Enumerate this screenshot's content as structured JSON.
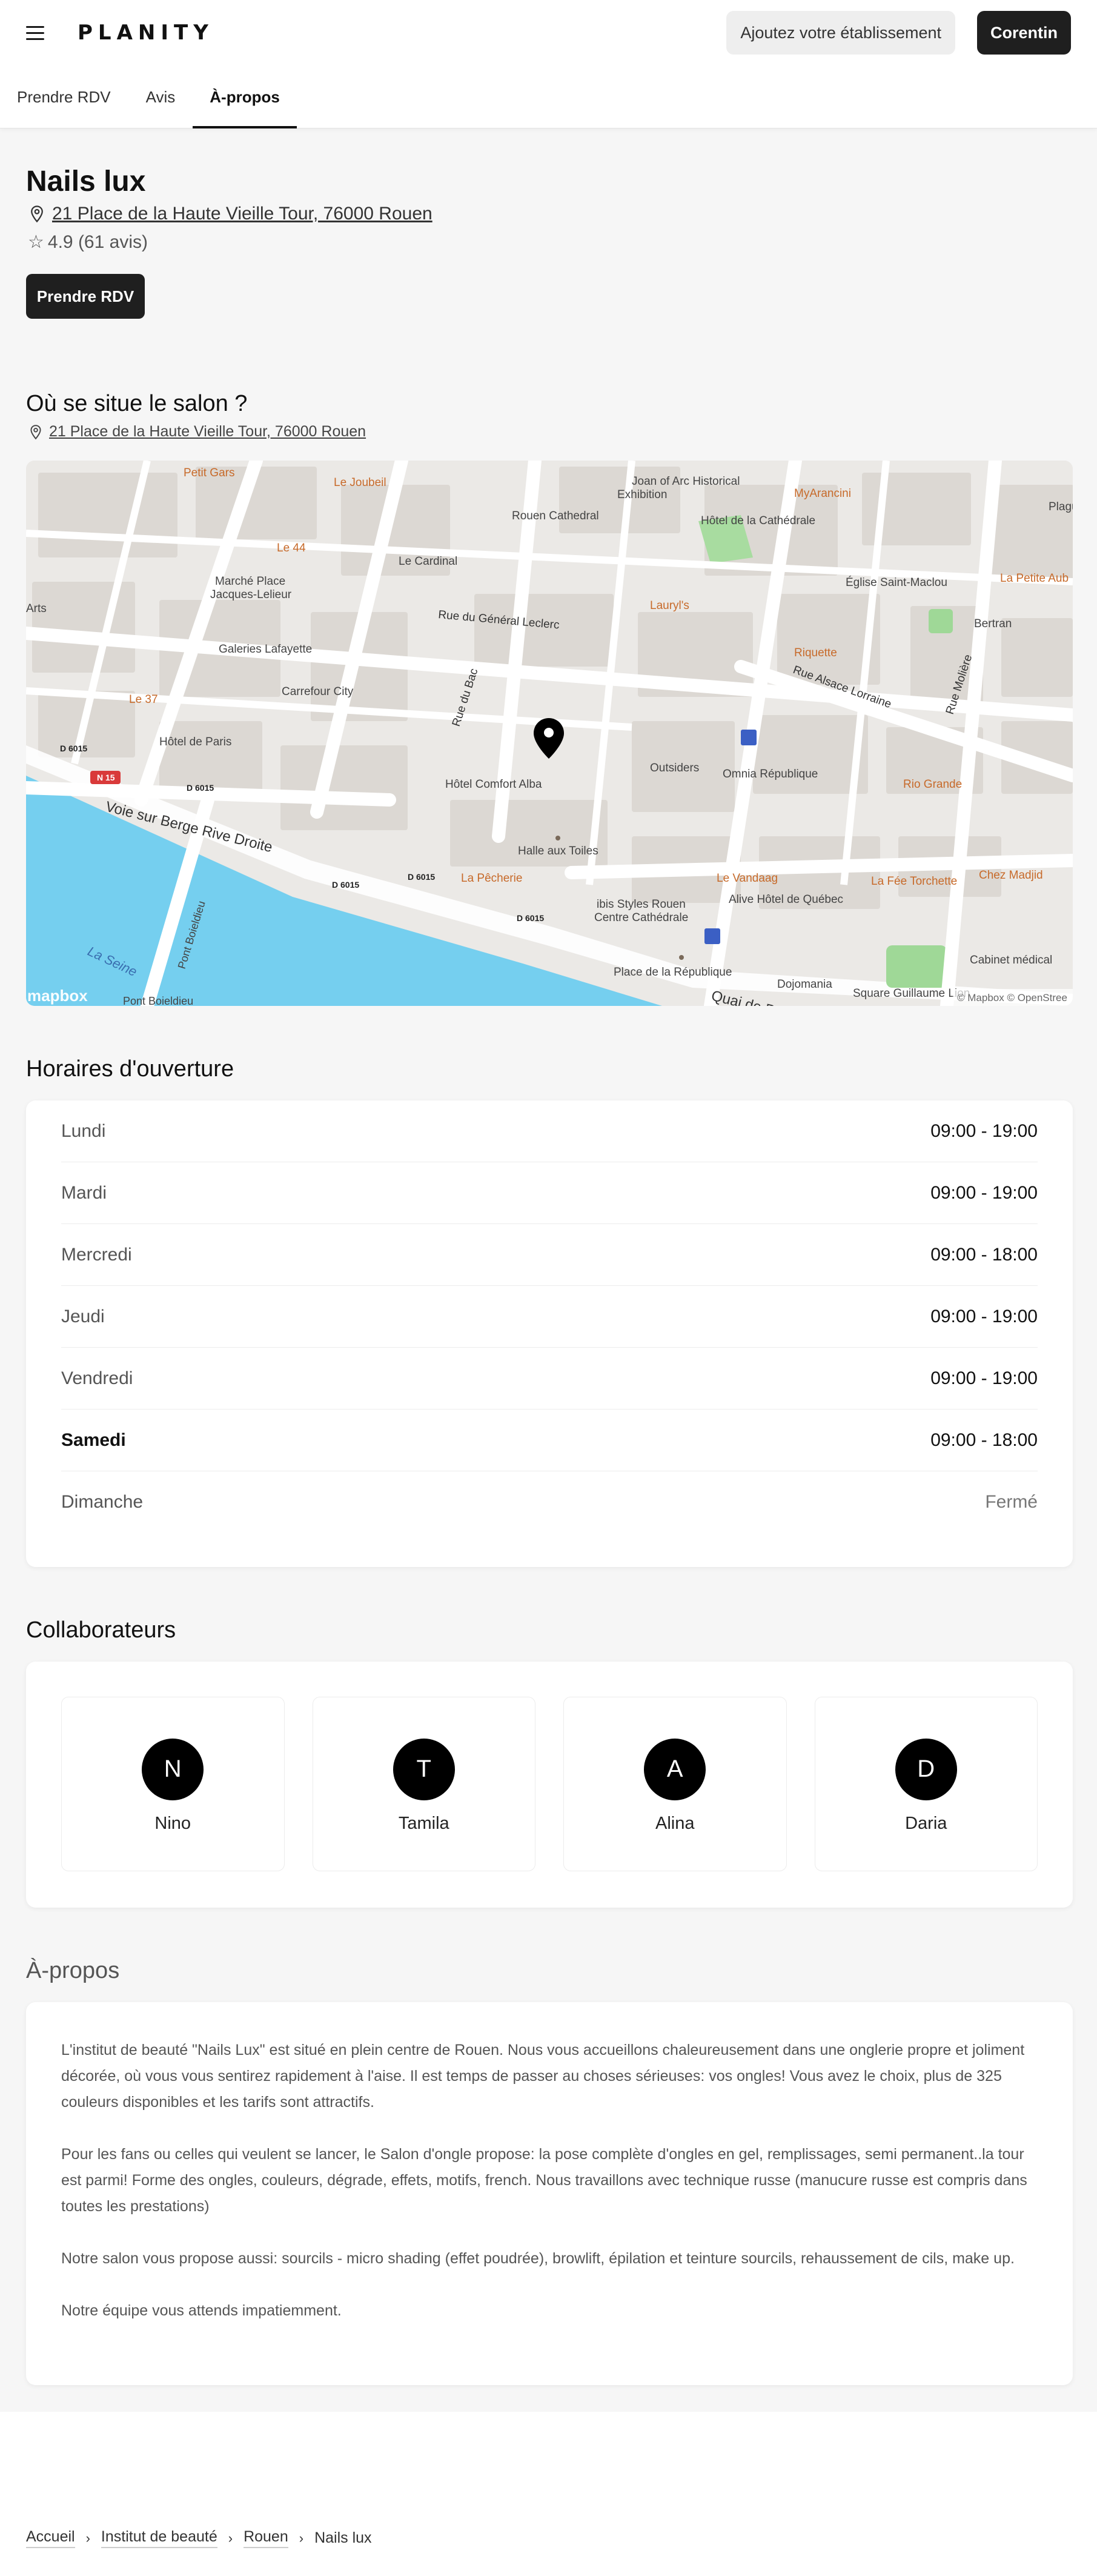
{
  "header": {
    "logo": "PLANITY",
    "add_business": "Ajoutez votre établissement",
    "user": "Corentin"
  },
  "tabs": [
    {
      "label": "Prendre RDV"
    },
    {
      "label": "Avis"
    },
    {
      "label": "À-propos"
    }
  ],
  "salon": {
    "name": "Nails lux",
    "address": "21 Place de la Haute Vieille Tour, 76000 Rouen",
    "rating": "4.9 (61 avis)",
    "book_label": "Prendre RDV"
  },
  "location": {
    "title": "Où se situe le salon ?",
    "address": "21 Place de la Haute Vieille Tour, 76000 Rouen"
  },
  "map": {
    "labels": {
      "petit_gars": "Petit Gars",
      "le_joubeil": "Le Joubeil",
      "joan": "Joan of Arc Historical",
      "exhibition": "Exhibition",
      "myarancini": "MyArancini",
      "plague": "Plague ceme",
      "le44": "Le 44",
      "rouen_cathedral": "Rouen Cathedral",
      "hotel_cathedrale": "Hôtel de la Cathédrale",
      "le_cardinal": "Le Cardinal",
      "marche": "Marché Place",
      "jacques": "Jacques-Lelieur",
      "eglise": "Église Saint-Maclou",
      "petite_aub": "La Petite Aub",
      "arts": "Arts",
      "lauryl": "Lauryl's",
      "bertran": "Bertran",
      "rue_leclerc": "Rue du Général Leclerc",
      "galeries": "Galeries Lafayette",
      "riquette": "Riquette",
      "rue_alsace": "Rue Alsace Lorraine",
      "rue_moliere": "Rue Molière",
      "le37": "Le 37",
      "carrefour": "Carrefour City",
      "rue_bac": "Rue du Bac",
      "hotel_paris": "Hôtel de Paris",
      "d6015": "D 6015",
      "n15": "N 15",
      "outsiders": "Outsiders",
      "omnia": "Omnia République",
      "rio_grande": "Rio Grande",
      "comfort": "Hôtel Comfort Alba",
      "voie": "Voie sur Berge Rive Droite",
      "halle": "Halle aux Toiles",
      "le_vandaag": "Le Vandaag",
      "fee": "La Fée Torchette",
      "chez_madjid": "Chez Madjid",
      "pecherie": "La Pêcherie",
      "ibis1": "ibis Styles Rouen",
      "ibis2": "Centre Cathédrale",
      "alive": "Alive Hôtel de Québec",
      "pont": "Pont Boieldieu",
      "la_seine": "La Seine",
      "cabinet": "Cabinet médical",
      "place_rep": "Place de la République",
      "dojomania": "Dojomania",
      "quai": "Quai de P",
      "square": "Square Guillaume Lion",
      "mapbox": "mapbox",
      "credits": "© Mapbox © OpenStree"
    }
  },
  "hours": {
    "title": "Horaires d'ouverture",
    "rows": [
      {
        "day": "Lundi",
        "time": "09:00 - 19:00"
      },
      {
        "day": "Mardi",
        "time": "09:00 - 19:00"
      },
      {
        "day": "Mercredi",
        "time": "09:00 - 18:00"
      },
      {
        "day": "Jeudi",
        "time": "09:00 - 19:00"
      },
      {
        "day": "Vendredi",
        "time": "09:00 - 19:00"
      },
      {
        "day": "Samedi",
        "time": "09:00 - 18:00"
      },
      {
        "day": "Dimanche",
        "time": "Fermé"
      }
    ]
  },
  "collaborators": {
    "title": "Collaborateurs",
    "list": [
      {
        "initial": "N",
        "name": "Nino"
      },
      {
        "initial": "T",
        "name": "Tamila"
      },
      {
        "initial": "A",
        "name": "Alina"
      },
      {
        "initial": "D",
        "name": "Daria"
      }
    ]
  },
  "about": {
    "title": "À-propos",
    "paragraphs": [
      "L'institut de beauté \"Nails Lux\" est situé en plein centre de Rouen. Nous vous accueillons chaleureusement dans une onglerie propre et joliment décorée, où vous vous sentirez rapidement à l'aise. Il est temps de passer au choses sérieuses: vos ongles! Vous avez le choix, plus de 325 couleurs disponibles et les tarifs sont attractifs.",
      "Pour les fans ou celles qui veulent se lancer, le Salon d'ongle propose: la pose complète d'ongles en gel, remplissages, semi permanent..la tour est parmi! Forme des ongles, couleurs, dégrade, effets, motifs, french. Nous travaillons avec technique russe (manucure russe est compris dans toutes les prestations)",
      "Notre salon vous propose aussi: sourcils - micro shading (effet poudrée), browlift, épilation et teinture sourcils, rehaussement de cils, make up.",
      "Notre équipe vous attends impatiemment."
    ]
  },
  "breadcrumb": [
    "Accueil",
    "Institut de beauté",
    "Rouen",
    "Nails lux"
  ]
}
